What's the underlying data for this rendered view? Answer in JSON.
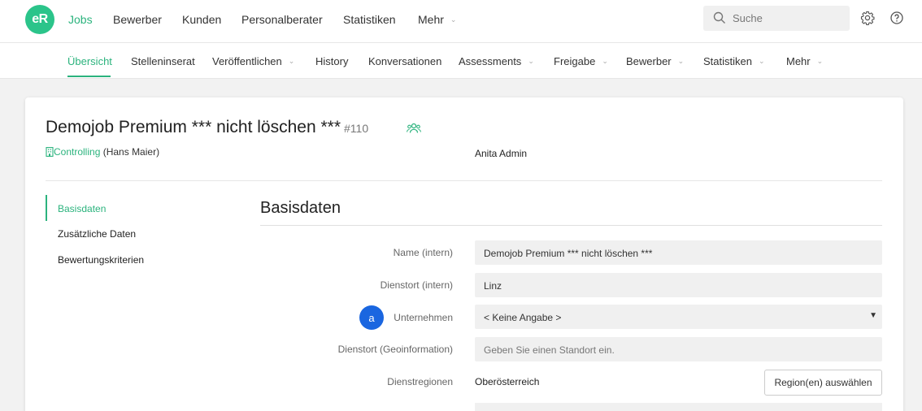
{
  "topnav": {
    "logo": "eR",
    "items": [
      {
        "label": "Jobs"
      },
      {
        "label": "Bewerber"
      },
      {
        "label": "Kunden"
      },
      {
        "label": "Personalberater"
      },
      {
        "label": "Statistiken"
      },
      {
        "label": "Mehr"
      }
    ],
    "search_placeholder": "Suche"
  },
  "subnav": {
    "items": [
      {
        "label": "Übersicht"
      },
      {
        "label": "Stelleninserat"
      },
      {
        "label": "Veröffentlichen"
      },
      {
        "label": "History"
      },
      {
        "label": "Konversationen"
      },
      {
        "label": "Assessments"
      },
      {
        "label": "Freigabe"
      },
      {
        "label": "Bewerber"
      },
      {
        "label": "Statistiken"
      },
      {
        "label": "Mehr"
      }
    ]
  },
  "job": {
    "title": "Demojob Premium *** nicht löschen ***",
    "id": "#110",
    "department": "Controlling",
    "manager": "(Hans Maier)",
    "owner": "Anita Admin"
  },
  "sidemenu": {
    "items": [
      {
        "label": "Basisdaten"
      },
      {
        "label": "Zusätzliche Daten"
      },
      {
        "label": "Bewertungskriterien"
      }
    ]
  },
  "form": {
    "section_title": "Basisdaten",
    "name_label": "Name (intern)",
    "name_value": "Demojob Premium *** nicht löschen ***",
    "location_label": "Dienstort (intern)",
    "location_value": "Linz",
    "company_label": "Unternehmen",
    "company_value": "< Keine Angabe >",
    "geo_label": "Dienstort (Geoinformation)",
    "geo_placeholder": "Geben Sie einen Standort ein.",
    "regions_label": "Dienstregionen",
    "regions_value": "Oberösterreich",
    "regions_button": "Region(en) auswählen"
  },
  "avatar_letter": "a",
  "colors": {
    "accent": "#2bb37d",
    "logo": "#2bc48a",
    "avatar": "#1a66e0"
  }
}
